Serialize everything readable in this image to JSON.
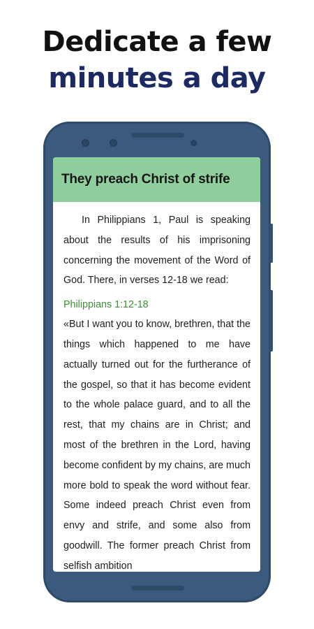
{
  "headline": {
    "line1": "Dedicate a few",
    "line2": "minutes a day"
  },
  "reader": {
    "title": "They preach Christ of strife",
    "intro": "In Philippians 1, Paul is speaking about the results of his imprisoning concerning the movement of the Word of God. There, in verses 12-18 we read:",
    "reference": "Philippians 1:12-18",
    "quote": "«But I want you to know, brethren, that the things which happened to me have actually turned out for the furtherance of the gospel, so that it has become evident to the whole palace guard, and to all the rest, that my chains are in Christ; and most of the brethren in the Lord, having become confident by my chains, are much more bold to speak the word without fear. Some indeed preach Christ even from envy and strife, and some also from goodwill. The former preach Christ from selfish ambition"
  },
  "colors": {
    "headline_primary": "#111111",
    "headline_accent": "#1b2a63",
    "phone_body": "#3b5a7d",
    "title_bar": "#8fcf9d",
    "reference_text": "#3f8f38"
  }
}
